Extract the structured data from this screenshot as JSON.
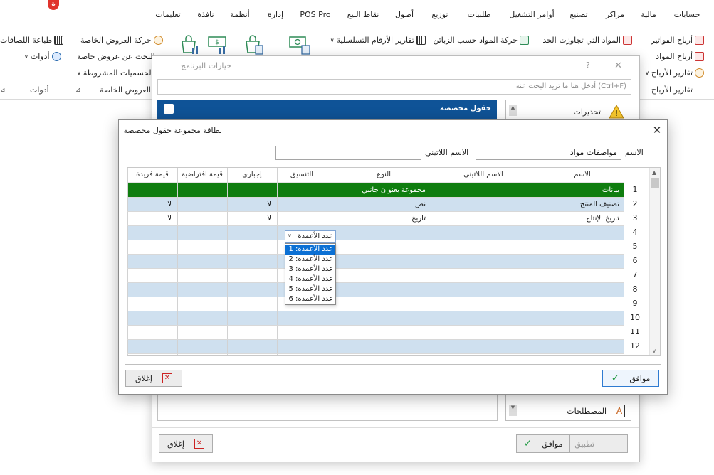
{
  "menu": {
    "badge": "ة",
    "items": [
      "حسابات",
      "مالية",
      "مراكز",
      "تصنيع",
      "أوامر التشغيل",
      "طلبيات",
      "توزيع",
      "أصول",
      "نقاط البيع",
      "POS Pro",
      "إدارة",
      "أنظمة",
      "نافذة",
      "تعليمات"
    ]
  },
  "ribbon": {
    "profits": {
      "invoices": "أرباح الفواتير",
      "materials": "أرباح المواد",
      "reports": "تقارير الأرباح",
      "group": "تقارير الأرباح"
    },
    "limits": {
      "exceeded": "المواد التي تجاوزت الحد",
      "by_customer": "حركة المواد حسب الزبائن"
    },
    "serial": {
      "reports": "تقارير الأرقام التسلسلية"
    },
    "offers": {
      "movement": "حركة العروض الخاصة",
      "search": "البحث عن عروض خاصة",
      "conditional": "الحسميات المشروطة",
      "group": "العروض الخاصة"
    },
    "tools": {
      "labels": "طباعة اللصاقات",
      "tools": "أدوات",
      "group": "أدوات"
    }
  },
  "options_dialog": {
    "title": "خيارات البرنامج",
    "help": "?",
    "close": "✕",
    "search_placeholder": "أدخل هنا ما تريد البحث عنه (Ctrl+F)",
    "panel_header": "حقول مخصصة",
    "tree": {
      "warnings": "تحذيرات",
      "terms": "المصطلحات"
    },
    "buttons": {
      "apply": "تطبيق",
      "ok": "موافق",
      "close": "إغلاق"
    }
  },
  "card": {
    "title": "بطاقة مجموعة حقول مخصصة",
    "close": "✕",
    "name_label": "الاسم",
    "name_value": "مواصفات مواد",
    "latin_label": "الاسم اللاتيني",
    "latin_value": "",
    "headers": {
      "name": "الاسم",
      "latin": "الاسم اللاتيني",
      "type": "النوع",
      "format": "التنسيق",
      "required": "إجباري",
      "default": "قيمة افتراضية",
      "unique": "قيمة فريدة"
    },
    "rows": [
      {
        "num": "1",
        "name": "بيانات",
        "latin": "",
        "type": "مجموعة بعنوان جانبي",
        "format": "عدد الأعمدة",
        "required": "",
        "default": "",
        "unique": ""
      },
      {
        "num": "2",
        "name": "تصنيف المنتج",
        "latin": "",
        "type": "نص",
        "format": "",
        "required": "لا",
        "default": "",
        "unique": "لا"
      },
      {
        "num": "3",
        "name": "تاريخ الإنتاج",
        "latin": "",
        "type": "تاريخ",
        "format": "",
        "required": "لا",
        "default": "",
        "unique": "لا"
      },
      {
        "num": "4"
      },
      {
        "num": "5"
      },
      {
        "num": "6"
      },
      {
        "num": "7"
      },
      {
        "num": "8"
      },
      {
        "num": "9"
      },
      {
        "num": "10"
      },
      {
        "num": "11"
      },
      {
        "num": "12"
      }
    ],
    "dropdown": {
      "value": "عدد الأعمدة",
      "options": [
        "عدد الأعمدة: 1",
        "عدد الأعمدة: 2",
        "عدد الأعمدة: 3",
        "عدد الأعمدة: 4",
        "عدد الأعمدة: 5",
        "عدد الأعمدة: 6"
      ],
      "selected_index": 0
    },
    "buttons": {
      "ok": "موافق",
      "close": "إغلاق"
    }
  },
  "colors": {
    "group_row": "#0f7d0f",
    "stripe": "#cfe0ef",
    "selection": "#0b70d4",
    "accent": "#0f5397"
  }
}
